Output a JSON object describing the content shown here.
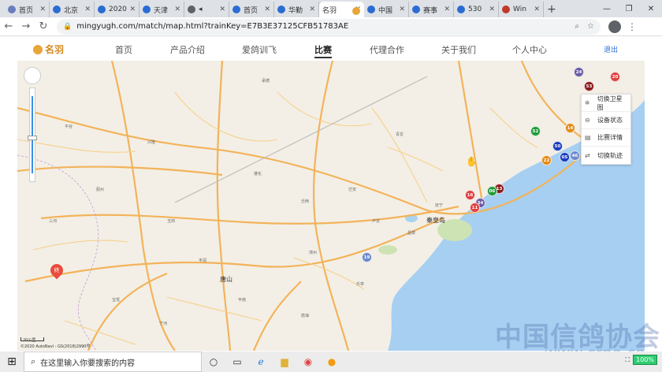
{
  "browser": {
    "tabs": [
      {
        "title": "首页",
        "icon": "globe"
      },
      {
        "title": "北京",
        "icon": "blue"
      },
      {
        "title": "2020",
        "icon": "blue"
      },
      {
        "title": "天津",
        "icon": "blue"
      },
      {
        "title": "◂ ",
        "icon": "earth"
      },
      {
        "title": "首页",
        "icon": "blue"
      },
      {
        "title": "华勤",
        "icon": "blue"
      },
      {
        "title": "名羽",
        "icon": "logo",
        "active": true
      },
      {
        "title": "中国",
        "icon": "blue"
      },
      {
        "title": "赛事",
        "icon": "blue"
      },
      {
        "title": "530",
        "icon": "blue"
      },
      {
        "title": "Win",
        "icon": "red"
      }
    ],
    "url": "mingyugh.com/match/map.html?trainKey=E7B3E37125CFB51783AE"
  },
  "site": {
    "logo_text": "名羽",
    "nav": [
      "首页",
      "产品介绍",
      "爱鸽训飞",
      "比赛",
      "代理合作",
      "关于我们",
      "个人中心"
    ],
    "active_nav": "比赛",
    "logout": "退出"
  },
  "map": {
    "cities": {
      "qinhuangdao": "秦皇岛",
      "tangshan": "唐山"
    },
    "end_pin_label": "终",
    "scale_label": "20公里",
    "copyright": "©2020 AutoNavi - GS(2018)2990号",
    "control_panel": [
      {
        "label": "切换卫星图",
        "icon": "satellite-icon"
      },
      {
        "label": "设备状态",
        "icon": "toggle-icon"
      },
      {
        "label": "比赛详情",
        "icon": "document-icon"
      },
      {
        "label": "切换轨迹",
        "icon": "swap-icon"
      }
    ],
    "markers": [
      {
        "id": "24",
        "color": "#6b5ca5"
      },
      {
        "id": "20",
        "color": "#e04040"
      },
      {
        "id": "53",
        "color": "#8b1a1a"
      },
      {
        "id": "14",
        "color": "#e58a1a"
      },
      {
        "id": "52",
        "color": "#1f9b3a"
      },
      {
        "id": "50",
        "color": "#1a3bbf"
      },
      {
        "id": "22",
        "color": "#e58a1a"
      },
      {
        "id": "05",
        "color": "#1a3bbf"
      },
      {
        "id": "46",
        "color": "#6b8acb"
      },
      {
        "id": "16",
        "color": "#e04040"
      },
      {
        "id": "13",
        "color": "#8b1a1a"
      },
      {
        "id": "06",
        "color": "#1f9b3a"
      },
      {
        "id": "34",
        "color": "#6b5ca5"
      },
      {
        "id": "19",
        "color": "#6b8acb"
      },
      {
        "id": "11",
        "color": "#e04040"
      }
    ],
    "place_labels": [
      "承德",
      "兴隆",
      "遵化",
      "迁西",
      "迁安",
      "青龙",
      "卢龙",
      "昌黎",
      "抚宁",
      "丰润",
      "玉田",
      "蓟州",
      "三河",
      "平谷",
      "滦州",
      "乐亭",
      "唐海",
      "宝坻",
      "宁河",
      "丰南"
    ]
  },
  "watermark": {
    "line1": "中国信鸽协会",
    "line2": "www.crpa.cn"
  },
  "taskbar": {
    "search_placeholder": "在这里输入你要搜索的内容",
    "battery": "100%"
  }
}
